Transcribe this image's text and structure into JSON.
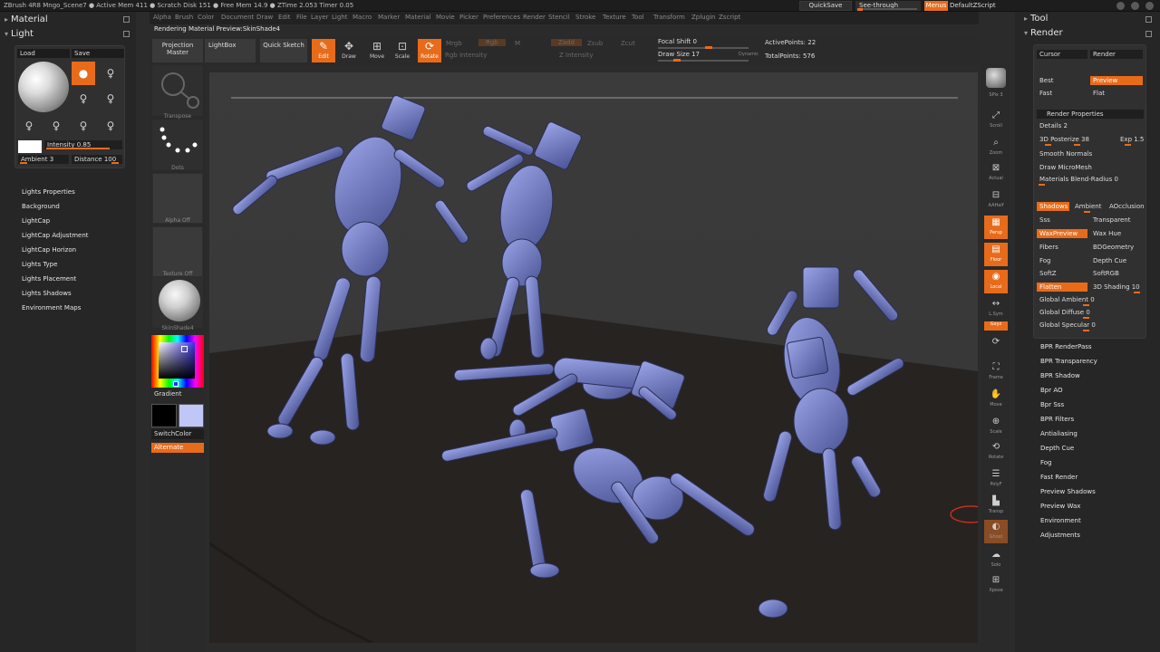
{
  "topbar": {
    "title": "ZBrush 4R8   Mngo_Scene7  ● Active Mem 411 ● Scratch Disk 151 ● Free Mem 14.9 ● ZTime 2.053 Timer 0.05",
    "quicksave": "QuickSave",
    "seethrough": "See-through",
    "menus": "Menus",
    "script": "DefaultZScript"
  },
  "left": {
    "material_title": "Material",
    "light_title": "Light",
    "load": "Load",
    "save": "Save",
    "intensity": "Intensity 0.85",
    "ambient": "Ambient 3",
    "distance": "Distance 100",
    "menu": [
      "Lights Properties",
      "Background",
      "LightCap",
      "LightCap Adjustment",
      "LightCap Horizon",
      "Lights Type",
      "Lights Placement",
      "Lights Shadows",
      "Environment Maps"
    ]
  },
  "leftstrip": {
    "labels": [
      "Transpose",
      "Dots",
      "Alpha Off",
      "Texture Off",
      "SkinShade4"
    ],
    "gradient": "Gradient",
    "switchcolor": "SwitchColor",
    "alternate": "Alternate"
  },
  "menubar": [
    "Alpha",
    "Brush",
    "Color",
    "Document",
    "Draw",
    "Edit",
    "File",
    "Layer",
    "Light",
    "Macro",
    "Marker",
    "Material",
    "Movie",
    "Picker",
    "Preferences",
    "Render",
    "Stencil",
    "Stroke",
    "Texture",
    "Tool",
    "Transform",
    "Zplugin",
    "Zscript"
  ],
  "status": "Rendering Material Preview:SkinShade4",
  "shelf": {
    "projection": "Projection Master",
    "lightbox": "LightBox",
    "quicksketch": "Quick Sketch",
    "edit": "Edit",
    "draw": "Draw",
    "move": "Move",
    "scale": "Scale",
    "rotate": "Rotate",
    "mrgb": "Mrgb",
    "rgb": "Rgb",
    "m": "M",
    "zadd": "Zadd",
    "zsub": "Zsub",
    "zcut": "Zcut",
    "rgb_intensity": "Rgb Intensity",
    "z_intensity": "Z Intensity",
    "focal_shift": "Focal Shift 0",
    "draw_size": "Draw Size 17",
    "dynamic": "Dynamic",
    "active_points": "ActivePoints: 22",
    "total_points": "TotalPoints: 576"
  },
  "rightshelf": [
    "BPR",
    "SPix 3",
    "Scroll",
    "Zoom",
    "Actual",
    "AAHalf",
    "Persp",
    "Floor",
    "Local",
    "L.Sym",
    "Gxyz",
    "Frame",
    "Move",
    "Scale",
    "Rotate",
    "PolyF",
    "Transp",
    "Ghost",
    "Solo",
    "Xpose"
  ],
  "right": {
    "tool_title": "Tool",
    "render_title": "Render",
    "cursor": "Cursor",
    "render_btn": "Render",
    "best": "Best",
    "preview": "Preview",
    "fast": "Fast",
    "flat": "Flat",
    "render_properties": "Render Properties",
    "details": "Details 2",
    "posterize": "3D Posterize 38",
    "exp": "Exp 1.5",
    "smooth_normals": "Smooth Normals",
    "draw_microrpoly": "Draw MicroMesh",
    "materials_blend": "Materials Blend-Radius 0",
    "shadows": "Shadows",
    "ambient": "Ambient",
    "aocclusion": "AOcclusion",
    "sss": "Sss",
    "transparent": "Transparent",
    "wax_preview": "WaxPreview",
    "wax_hue": "Wax Hue",
    "fibers": "Fibers",
    "bdgeometry": "BDGeometry",
    "fog": "Fog",
    "depth_cue": "Depth Cue",
    "softz": "SoftZ",
    "softrgb": "SoftRGB",
    "flatten": "Flatten",
    "shading": "3D Shading 10",
    "global_ambient": "Global Ambient 0",
    "global_diffuse": "Global Diffuse 0",
    "global_specular": "Global Specular 0",
    "menu": [
      "BPR RenderPass",
      "BPR Transparency",
      "BPR Shadow",
      "Bpr AO",
      "Bpr Sss",
      "BPR Filters",
      "Antialiasing",
      "Depth Cue",
      "Fog",
      "Fast Render",
      "Preview Shadows",
      "Preview Wax",
      "Environment",
      "Adjustments"
    ]
  },
  "colors": {
    "accent": "#e86b1a",
    "figure": "#6f7bc4",
    "floor": "#272320"
  }
}
